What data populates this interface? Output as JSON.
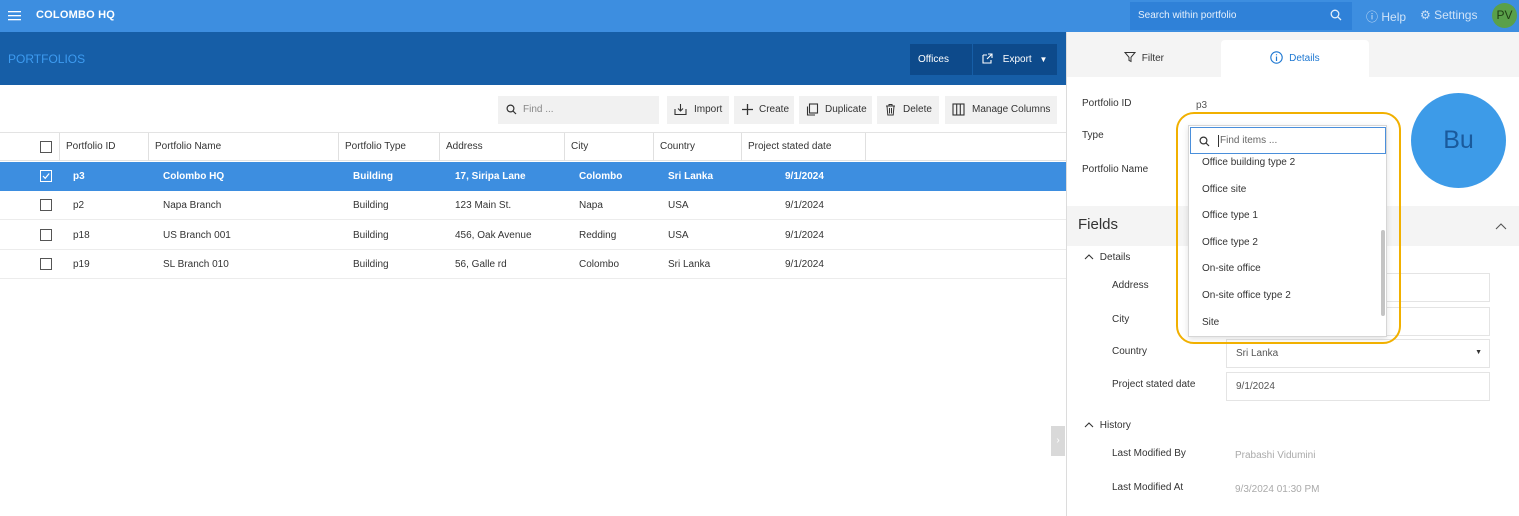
{
  "topbar": {
    "app_title": "COLOMBO HQ",
    "search_placeholder": "Search within portfolio",
    "help_label": "Help",
    "settings_label": "Settings",
    "avatar_initials": "PV",
    "menu_icon": "hamburger-icon"
  },
  "header": {
    "title": "PORTFOLIOS",
    "offices_label": "Offices",
    "export_label": "Export"
  },
  "toolbar": {
    "find_placeholder": "Find ...",
    "import_label": "Import",
    "create_label": "Create",
    "duplicate_label": "Duplicate",
    "delete_label": "Delete",
    "manage_columns_label": "Manage Columns"
  },
  "grid": {
    "columns": [
      "Portfolio ID",
      "Portfolio Name",
      "Portfolio Type",
      "Address",
      "City",
      "Country",
      "Project stated date"
    ],
    "rows": [
      {
        "id": "p3",
        "name": "Colombo HQ",
        "type": "Building",
        "address": "17, Siripa Lane",
        "city": "Colombo",
        "country": "Sri Lanka",
        "date": "9/1/2024",
        "selected": true
      },
      {
        "id": "p2",
        "name": "Napa Branch",
        "type": "Building",
        "address": "123 Main St.",
        "city": "Napa",
        "country": "USA",
        "date": "9/1/2024",
        "selected": false
      },
      {
        "id": "p18",
        "name": "US Branch 001",
        "type": "Building",
        "address": "456, Oak Avenue",
        "city": "Redding",
        "country": "USA",
        "date": "9/1/2024",
        "selected": false
      },
      {
        "id": "p19",
        "name": "SL Branch 010",
        "type": "Building",
        "address": "56, Galle rd",
        "city": "Colombo",
        "country": "Sri Lanka",
        "date": "9/1/2024",
        "selected": false
      }
    ]
  },
  "panel": {
    "tab_filter": "Filter",
    "tab_details": "Details",
    "portfolio_id_label": "Portfolio ID",
    "portfolio_id_value": "p3",
    "type_label": "Type",
    "portfolio_name_label": "Portfolio Name",
    "avatar_text": "Bu",
    "fields_title": "Fields",
    "details_section": "Details",
    "address_label": "Address",
    "city_label": "City",
    "country_label": "Country",
    "country_value": "Sri Lanka",
    "project_date_label": "Project stated date",
    "project_date_value": "9/1/2024",
    "history_section": "History",
    "last_modified_by_label": "Last Modified By",
    "last_modified_by_value": "Prabashi Vidumini",
    "last_modified_at_label": "Last Modified At",
    "last_modified_at_value": "9/3/2024 01:30 PM"
  },
  "type_dropdown": {
    "placeholder": "Find items ...",
    "options": [
      "Office building type 2",
      "Office site",
      "Office type 1",
      "Office type 2",
      "On-site office",
      "On-site office type 2",
      "Site"
    ]
  },
  "colors": {
    "topbar": "#3d8ee0",
    "header_band": "#165ea7",
    "selected_row": "#3d8ee0",
    "highlight": "#f1b000"
  }
}
